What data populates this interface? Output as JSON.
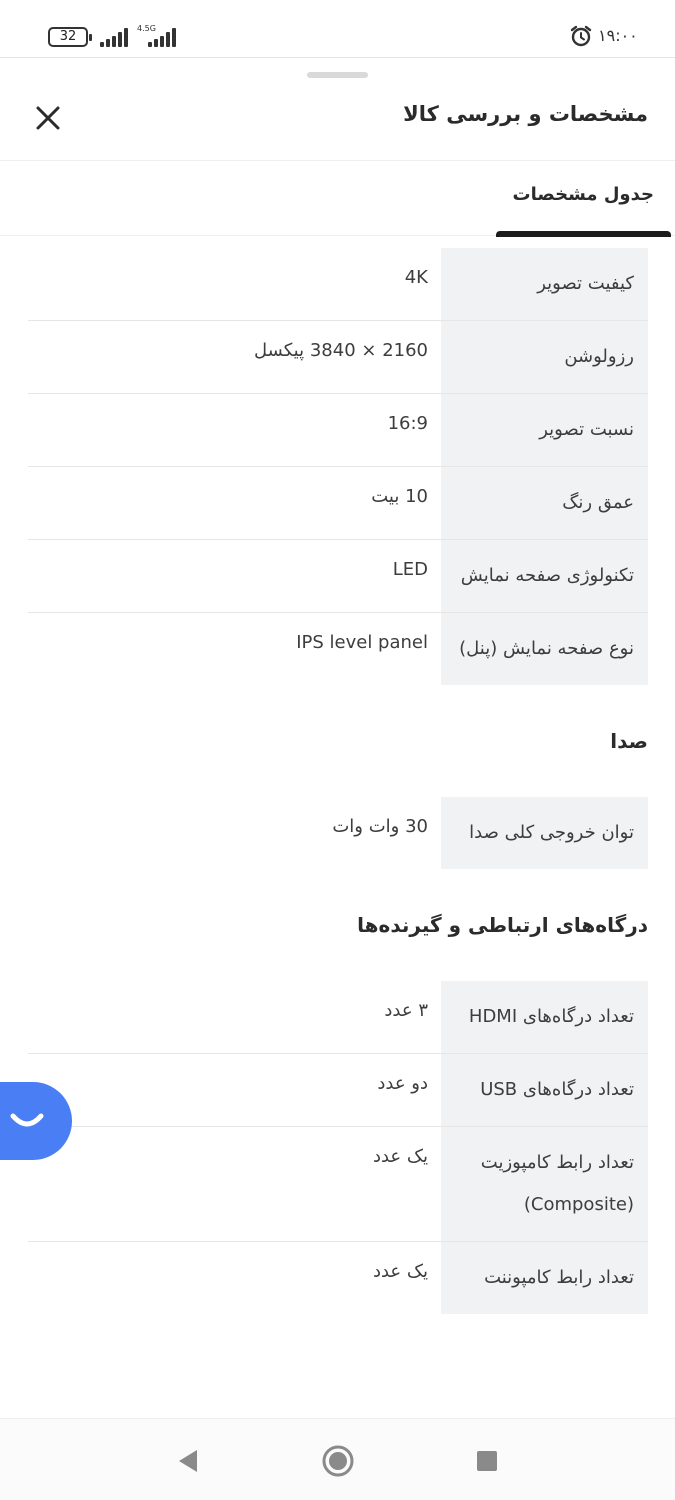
{
  "status_bar": {
    "battery": "32",
    "network_type": "4.5G",
    "time": "۱۹:۰۰",
    "icons": [
      "battery-icon",
      "signal-icon",
      "alarm-icon"
    ]
  },
  "header": {
    "title": "مشخصات و بررسی کالا",
    "close_icon": "close-icon"
  },
  "tabs": [
    {
      "label": "جدول مشخصات",
      "active": true
    }
  ],
  "specs": {
    "display": [
      {
        "key": "کیفیت تصویر",
        "value": "4K"
      },
      {
        "key": "رزولوشن",
        "value": "2160 × 3840 پیکسل"
      },
      {
        "key": "نسبت تصویر",
        "value": "16:9"
      },
      {
        "key": "عمق رنگ",
        "value": "10 بیت"
      },
      {
        "key": "تکنولوژی صفحه نمایش",
        "value": "LED"
      },
      {
        "key": "نوع صفحه نمایش (پنل)",
        "value": "IPS level panel"
      }
    ],
    "sound": {
      "title": "صدا",
      "rows": [
        {
          "key": "توان خروجی کلی صدا",
          "value": "30 وات وات"
        }
      ]
    },
    "ports": {
      "title": "درگاه‌های ارتباطی و گیرنده‌ها",
      "rows": [
        {
          "key": "تعداد درگاه‌های HDMI",
          "value": "۳ عدد"
        },
        {
          "key": "تعداد درگاه‌های USB",
          "value": "دو عدد"
        },
        {
          "key": "تعداد رابط کامپوزیت (Composite)",
          "value": "یک عدد"
        },
        {
          "key": "تعداد رابط کامپوننت",
          "value": "یک عدد"
        }
      ]
    }
  },
  "fab": {
    "icon": "chat-smile-icon"
  },
  "navbar": {
    "icons": [
      "back-icon",
      "home-icon",
      "recents-icon"
    ]
  },
  "colors": {
    "accent": "#4a7ef5",
    "key_bg": "#f1f2f4",
    "tab_indicator": "#1c1c1c"
  }
}
